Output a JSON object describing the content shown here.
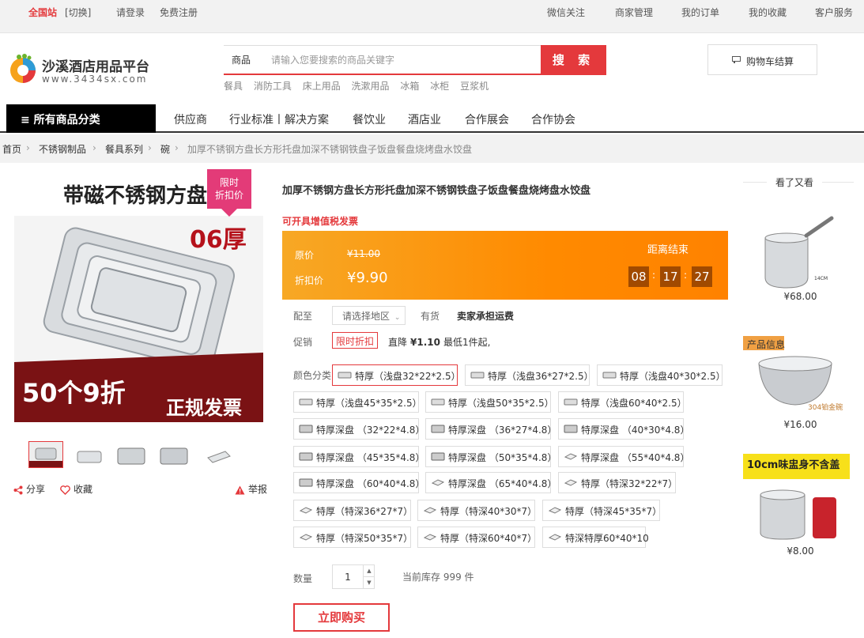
{
  "topbar": {
    "site": "全国站",
    "switch": "[切换]",
    "login": "请登录",
    "register": "免费注册",
    "wechat": "微信关注",
    "merchant": "商家管理",
    "orders": "我的订单",
    "favorites": "我的收藏",
    "service": "客户服务"
  },
  "logo": {
    "title": "沙溪酒店用品平台",
    "url": "www.3434sx.com"
  },
  "search": {
    "category": "商品",
    "placeholder": "请输入您要搜索的商品关键字",
    "button": "搜 索",
    "hot_words": [
      "餐具",
      "消防工具",
      "床上用品",
      "洗漱用品",
      "冰箱",
      "冰柜",
      "豆浆机"
    ]
  },
  "cart": {
    "label": "购物车结算"
  },
  "nav": {
    "all_categories": "≡ 所有商品分类",
    "items": [
      "供应商",
      "行业标准丨解决方案",
      "餐饮业",
      "酒店业",
      "合作展会",
      "合作协会"
    ]
  },
  "breadcrumb": {
    "items": [
      "首页",
      "不锈钢制品",
      "餐具系列",
      "碗"
    ],
    "current": "加厚不锈钢方盘长方形托盘加深不锈钢铁盘子饭盘餐盘烧烤盘水饺盘"
  },
  "gallery": {
    "promo_tag_line1": "限时",
    "promo_tag_line2": "折扣价",
    "img_headline": "带磁不锈钢方盘",
    "img_badge": "06厚",
    "img_footer_left": "50个9折",
    "img_footer_right": "正规发票"
  },
  "tools": {
    "share": "分享",
    "favorite": "收藏",
    "report": "举报"
  },
  "product": {
    "title": "加厚不锈钢方盘长方形托盘加深不锈钢铁盘子饭盘餐盘烧烤盘水饺盘",
    "vat": "可开具增值税发票",
    "original_label": "原价",
    "original_price": "¥11.00",
    "discount_label": "折扣价",
    "discount_price": "¥9.90",
    "countdown_label": "距离结束",
    "countdown": [
      "08",
      "17",
      "27"
    ],
    "ship_label": "配至",
    "region_placeholder": "请选择地区",
    "stock_status": "有货",
    "shipping": "卖家承担运费",
    "promo_label": "促销",
    "promo_badge": "限时折扣",
    "promo_direct": "直降",
    "promo_amount": "¥1.10",
    "promo_min": "最低1件起,",
    "color_label": "颜色分类",
    "options": [
      "特厚（浅盘32*22*2.5）",
      "特厚（浅盘36*27*2.5）",
      "特厚（浅盘40*30*2.5）",
      "特厚（浅盘45*35*2.5）",
      "特厚（浅盘50*35*2.5）",
      "特厚（浅盘60*40*2.5）",
      "特厚深盘 （32*22*4.8）",
      "特厚深盘 （36*27*4.8）",
      "特厚深盘 （40*30*4.8）",
      "特厚深盘 （45*35*4.8）",
      "特厚深盘 （50*35*4.8）",
      "特厚深盘 （55*40*4.8）",
      "特厚深盘 （60*40*4.8）",
      "特厚深盘 （65*40*4.8）",
      "特厚（特深32*22*7）",
      "特厚（特深36*27*7）",
      "特厚（特深40*30*7）",
      "特厚（特深45*35*7）",
      "特厚（特深50*35*7）",
      "特厚（特深60*40*7）",
      "特深特厚60*40*10"
    ],
    "qty_label": "数量",
    "qty": "1",
    "inventory": "当前库存 999 件",
    "buy": "立即购买"
  },
  "rail": {
    "title": "看了又看",
    "items": [
      {
        "price": "¥68.00"
      },
      {
        "price": "¥16.00",
        "tag": "产品信息",
        "caption": "304铂金碗"
      },
      {
        "price": "¥8.00",
        "banner": "10cm味盅身不含盖"
      }
    ]
  },
  "colors": {
    "accent": "#e4393c",
    "price_box": "#ff8a00",
    "promo_tag": "#e33b78"
  }
}
